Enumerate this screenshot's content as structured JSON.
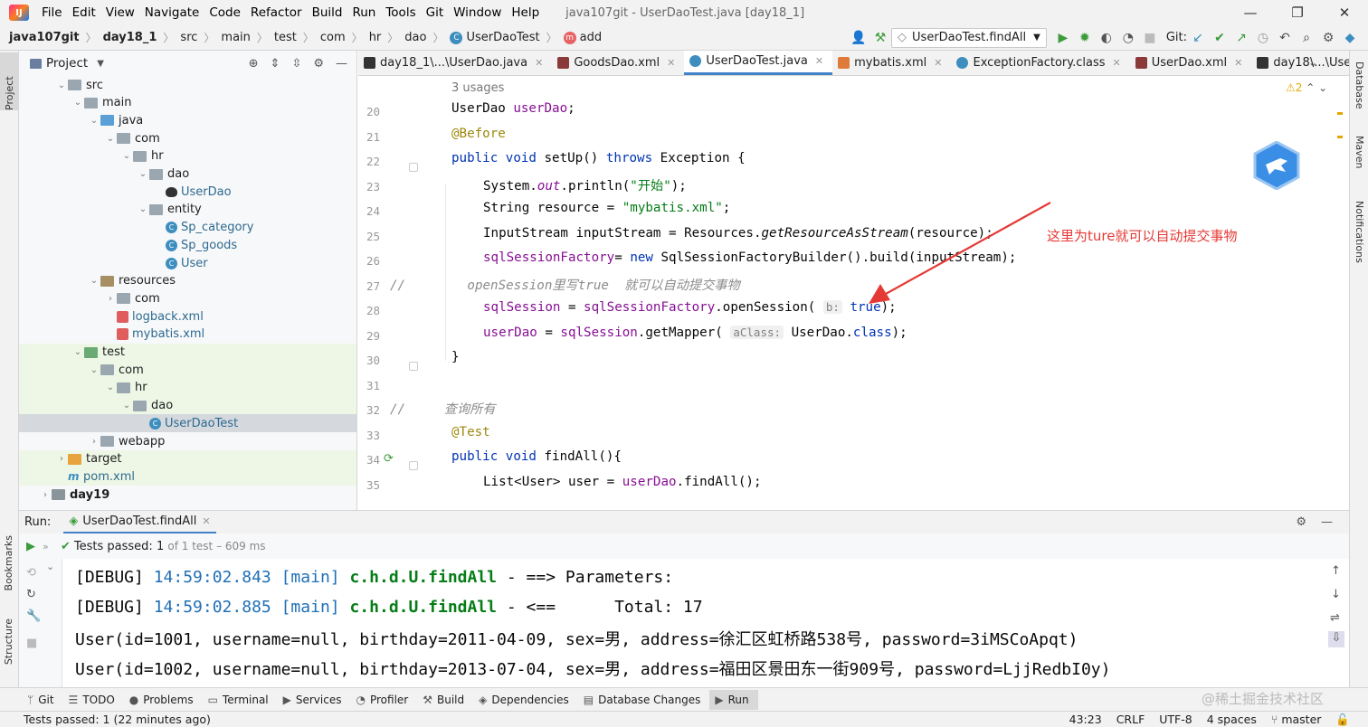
{
  "window": {
    "title": "java107git - UserDaoTest.java [day18_1]",
    "menu": [
      "File",
      "Edit",
      "View",
      "Navigate",
      "Code",
      "Refactor",
      "Build",
      "Run",
      "Tools",
      "Git",
      "Window",
      "Help"
    ],
    "controls": {
      "minimize": "—",
      "maximize": "❐",
      "close": "✕"
    }
  },
  "breadcrumb": {
    "project": "java107git",
    "module": "day18_1",
    "p1": "src",
    "p2": "main",
    "p3": "test",
    "p4": "com",
    "p5": "hr",
    "p6": "dao",
    "cls": "UserDaoTest",
    "method": "add"
  },
  "runconfig": {
    "label": "UserDaoTest.findAll",
    "git_label": "Git:"
  },
  "strips": {
    "left_top": "Project",
    "left_mid": "Bookmarks",
    "left_bot": "Structure",
    "right_top": "Database",
    "right_mid": "Maven",
    "right_bot": "Notifications"
  },
  "project": {
    "header": "Project",
    "tree": [
      {
        "label": "src",
        "indent": 1,
        "type": "folder",
        "open": true
      },
      {
        "label": "main",
        "indent": 2,
        "type": "folder",
        "open": true
      },
      {
        "label": "java",
        "indent": 3,
        "type": "blue",
        "open": true
      },
      {
        "label": "com",
        "indent": 4,
        "type": "folder",
        "open": true
      },
      {
        "label": "hr",
        "indent": 5,
        "type": "folder",
        "open": true
      },
      {
        "label": "dao",
        "indent": 6,
        "type": "folder",
        "open": true
      },
      {
        "label": "UserDao",
        "indent": 7,
        "type": "bird",
        "color": "#2d6a8f"
      },
      {
        "label": "entity",
        "indent": 6,
        "type": "folder",
        "open": true
      },
      {
        "label": "Sp_category",
        "indent": 7,
        "type": "class",
        "color": "#2d6a8f"
      },
      {
        "label": "Sp_goods",
        "indent": 7,
        "type": "class",
        "color": "#2d6a8f"
      },
      {
        "label": "User",
        "indent": 7,
        "type": "class",
        "color": "#2d6a8f"
      },
      {
        "label": "resources",
        "indent": 3,
        "type": "res",
        "open": true
      },
      {
        "label": "com",
        "indent": 4,
        "type": "folder",
        "open": false
      },
      {
        "label": "logback.xml",
        "indent": 4,
        "type": "xml",
        "color": "#2d6a8f"
      },
      {
        "label": "mybatis.xml",
        "indent": 4,
        "type": "xml",
        "color": "#2d6a8f"
      },
      {
        "label": "test",
        "indent": 2,
        "type": "green",
        "open": true,
        "hl": true
      },
      {
        "label": "com",
        "indent": 3,
        "type": "folder",
        "open": true,
        "hl": true
      },
      {
        "label": "hr",
        "indent": 4,
        "type": "folder",
        "open": true,
        "hl": true
      },
      {
        "label": "dao",
        "indent": 5,
        "type": "folder",
        "open": true,
        "hl": true
      },
      {
        "label": "UserDaoTest",
        "indent": 6,
        "type": "class",
        "color": "#2d6a8f",
        "sel": true
      },
      {
        "label": "webapp",
        "indent": 3,
        "type": "folder",
        "open": false
      },
      {
        "label": "target",
        "indent": 1,
        "type": "orange",
        "open": false,
        "hl": true
      },
      {
        "label": "pom.xml",
        "indent": 1,
        "type": "maven",
        "color": "#2d6a8f",
        "hl": true
      },
      {
        "label": "day19",
        "indent": 0,
        "type": "dark",
        "open": false,
        "bold": true
      }
    ]
  },
  "tabs": [
    {
      "label": "day18_1\\...\\UserDao.java",
      "icon": "#333"
    },
    {
      "label": "GoodsDao.xml",
      "icon": "#8b3a3a"
    },
    {
      "label": "UserDaoTest.java",
      "icon": "#3d8ebf",
      "active": true
    },
    {
      "label": "mybatis.xml",
      "icon": "#e07a3a"
    },
    {
      "label": "ExceptionFactory.class",
      "icon": "#3d8ebf"
    },
    {
      "label": "UserDao.xml",
      "icon": "#8b3a3a"
    },
    {
      "label": "day18\\...\\UserDao.java",
      "icon": "#333"
    }
  ],
  "editor": {
    "usages": "3 usages",
    "warnings": "⚠2",
    "lines": [
      {
        "n": "20",
        "html": "<span class='kw'></span>UserDao <span class='fld'>userDao</span>;",
        "t": [
          "UserDao ",
          "userDao",
          ";"
        ],
        "c": [
          "",
          "fld",
          ""
        ],
        "x": 0
      },
      {
        "n": "21",
        "t": [
          "@Before"
        ],
        "c": [
          "ann"
        ],
        "x": 0
      },
      {
        "n": "22",
        "t": [
          "public ",
          "void ",
          "setUp",
          "() ",
          "throws ",
          "Exception {"
        ],
        "c": [
          "kw",
          "kw",
          "",
          "",
          "kw",
          ""
        ],
        "x": 0
      },
      {
        "n": "23",
        "t": [
          "System.",
          "out",
          ".println(",
          "\"开始\"",
          ");"
        ],
        "c": [
          "",
          "fld itl",
          "",
          "str",
          ""
        ],
        "x": 1
      },
      {
        "n": "24",
        "t": [
          "String resource = ",
          "\"mybatis.xml\"",
          ";"
        ],
        "c": [
          "",
          "str",
          ""
        ],
        "x": 1
      },
      {
        "n": "25",
        "t": [
          "InputStream inputStream = Resources.",
          "getResourceAsStream",
          "(resource);"
        ],
        "c": [
          "",
          "itl",
          ""
        ],
        "x": 1
      },
      {
        "n": "26",
        "t": [
          "sqlSessionFactory",
          "= ",
          "new ",
          "SqlSessionFactoryBuilder().build(inputStream);"
        ],
        "c": [
          "fld",
          "",
          "kw",
          ""
        ],
        "x": 1
      },
      {
        "n": "27",
        "t": [
          "//        openSession里写true  就可以自动提交事物"
        ],
        "c": [
          "cmt"
        ],
        "x": -1
      },
      {
        "n": "28",
        "t": [
          "sqlSession",
          " = ",
          "sqlSessionFactory",
          ".openSession( ",
          "b:",
          " ",
          "true",
          ");"
        ],
        "c": [
          "fld",
          "",
          "fld",
          "",
          "hint",
          "",
          "kw",
          ""
        ],
        "x": 1
      },
      {
        "n": "29",
        "t": [
          "userDao",
          " = ",
          "sqlSession",
          ".getMapper( ",
          "aClass:",
          " UserDao.",
          "class",
          ");"
        ],
        "c": [
          "fld",
          "",
          "fld",
          "",
          "hint",
          "",
          "kw",
          ""
        ],
        "x": 1
      },
      {
        "n": "30",
        "t": [
          "}"
        ],
        "c": [
          ""
        ],
        "x": 0
      },
      {
        "n": "31",
        "t": [
          ""
        ],
        "c": [
          ""
        ],
        "x": 0
      },
      {
        "n": "32",
        "t": [
          "//     查询所有"
        ],
        "c": [
          "cmt"
        ],
        "x": -1
      },
      {
        "n": "33",
        "t": [
          "@Test"
        ],
        "c": [
          "ann"
        ],
        "x": 0
      },
      {
        "n": "34",
        "t": [
          "public ",
          "void ",
          "findAll",
          "(){"
        ],
        "c": [
          "kw",
          "kw",
          "",
          ""
        ],
        "x": 0
      },
      {
        "n": "35",
        "t": [
          "List<User> user = ",
          "userDao",
          ".findAll();"
        ],
        "c": [
          "",
          "fld",
          ""
        ],
        "x": 1
      }
    ],
    "annotation": "这里为ture就可以自动提交事物"
  },
  "run": {
    "label": "Run:",
    "tab": "UserDaoTest.findAll",
    "status_pass": "Tests passed:",
    "status_count": "1",
    "status_detail": "of 1 test – 609 ms",
    "console": [
      {
        "t": [
          "[DEBUG] ",
          "14:59:02.843",
          " ",
          "[main]",
          " ",
          "c.h.d.U.findAll",
          " - ==> Parameters: "
        ],
        "c": [
          "",
          "ts",
          "",
          "thr",
          "",
          "lg",
          ""
        ]
      },
      {
        "t": [
          "[DEBUG] ",
          "14:59:02.885",
          " ",
          "[main]",
          " ",
          "c.h.d.U.findAll",
          " - <==      Total: 17"
        ],
        "c": [
          "",
          "ts",
          "",
          "thr",
          "",
          "lg",
          ""
        ]
      },
      {
        "t": [
          "User(id=1001, username=null, birthday=2011-04-09, sex=男, address=徐汇区虹桥路538号, password=3iMSCoApqt)"
        ],
        "c": [
          ""
        ]
      },
      {
        "t": [
          "User(id=1002, username=null, birthday=2013-07-04, sex=男, address=福田区景田东一街909号, password=LjjRedbI0y)"
        ],
        "c": [
          ""
        ]
      }
    ]
  },
  "toolwindows": [
    {
      "label": "Git",
      "g": "ᛘ"
    },
    {
      "label": "TODO",
      "g": "☰"
    },
    {
      "label": "Problems",
      "g": "●"
    },
    {
      "label": "Terminal",
      "g": "▭"
    },
    {
      "label": "Services",
      "g": "▶"
    },
    {
      "label": "Profiler",
      "g": "◔"
    },
    {
      "label": "Build",
      "g": "⚒"
    },
    {
      "label": "Dependencies",
      "g": "◈"
    },
    {
      "label": "Database Changes",
      "g": "▤"
    },
    {
      "label": "Run",
      "g": "▶",
      "active": true
    }
  ],
  "statusbar": {
    "left": "Tests passed: 1 (22 minutes ago)",
    "pos": "43:23",
    "eol": "CRLF",
    "enc": "UTF-8",
    "indent": "4 spaces",
    "branch": "master"
  },
  "watermark": "@稀土掘金技术社区"
}
